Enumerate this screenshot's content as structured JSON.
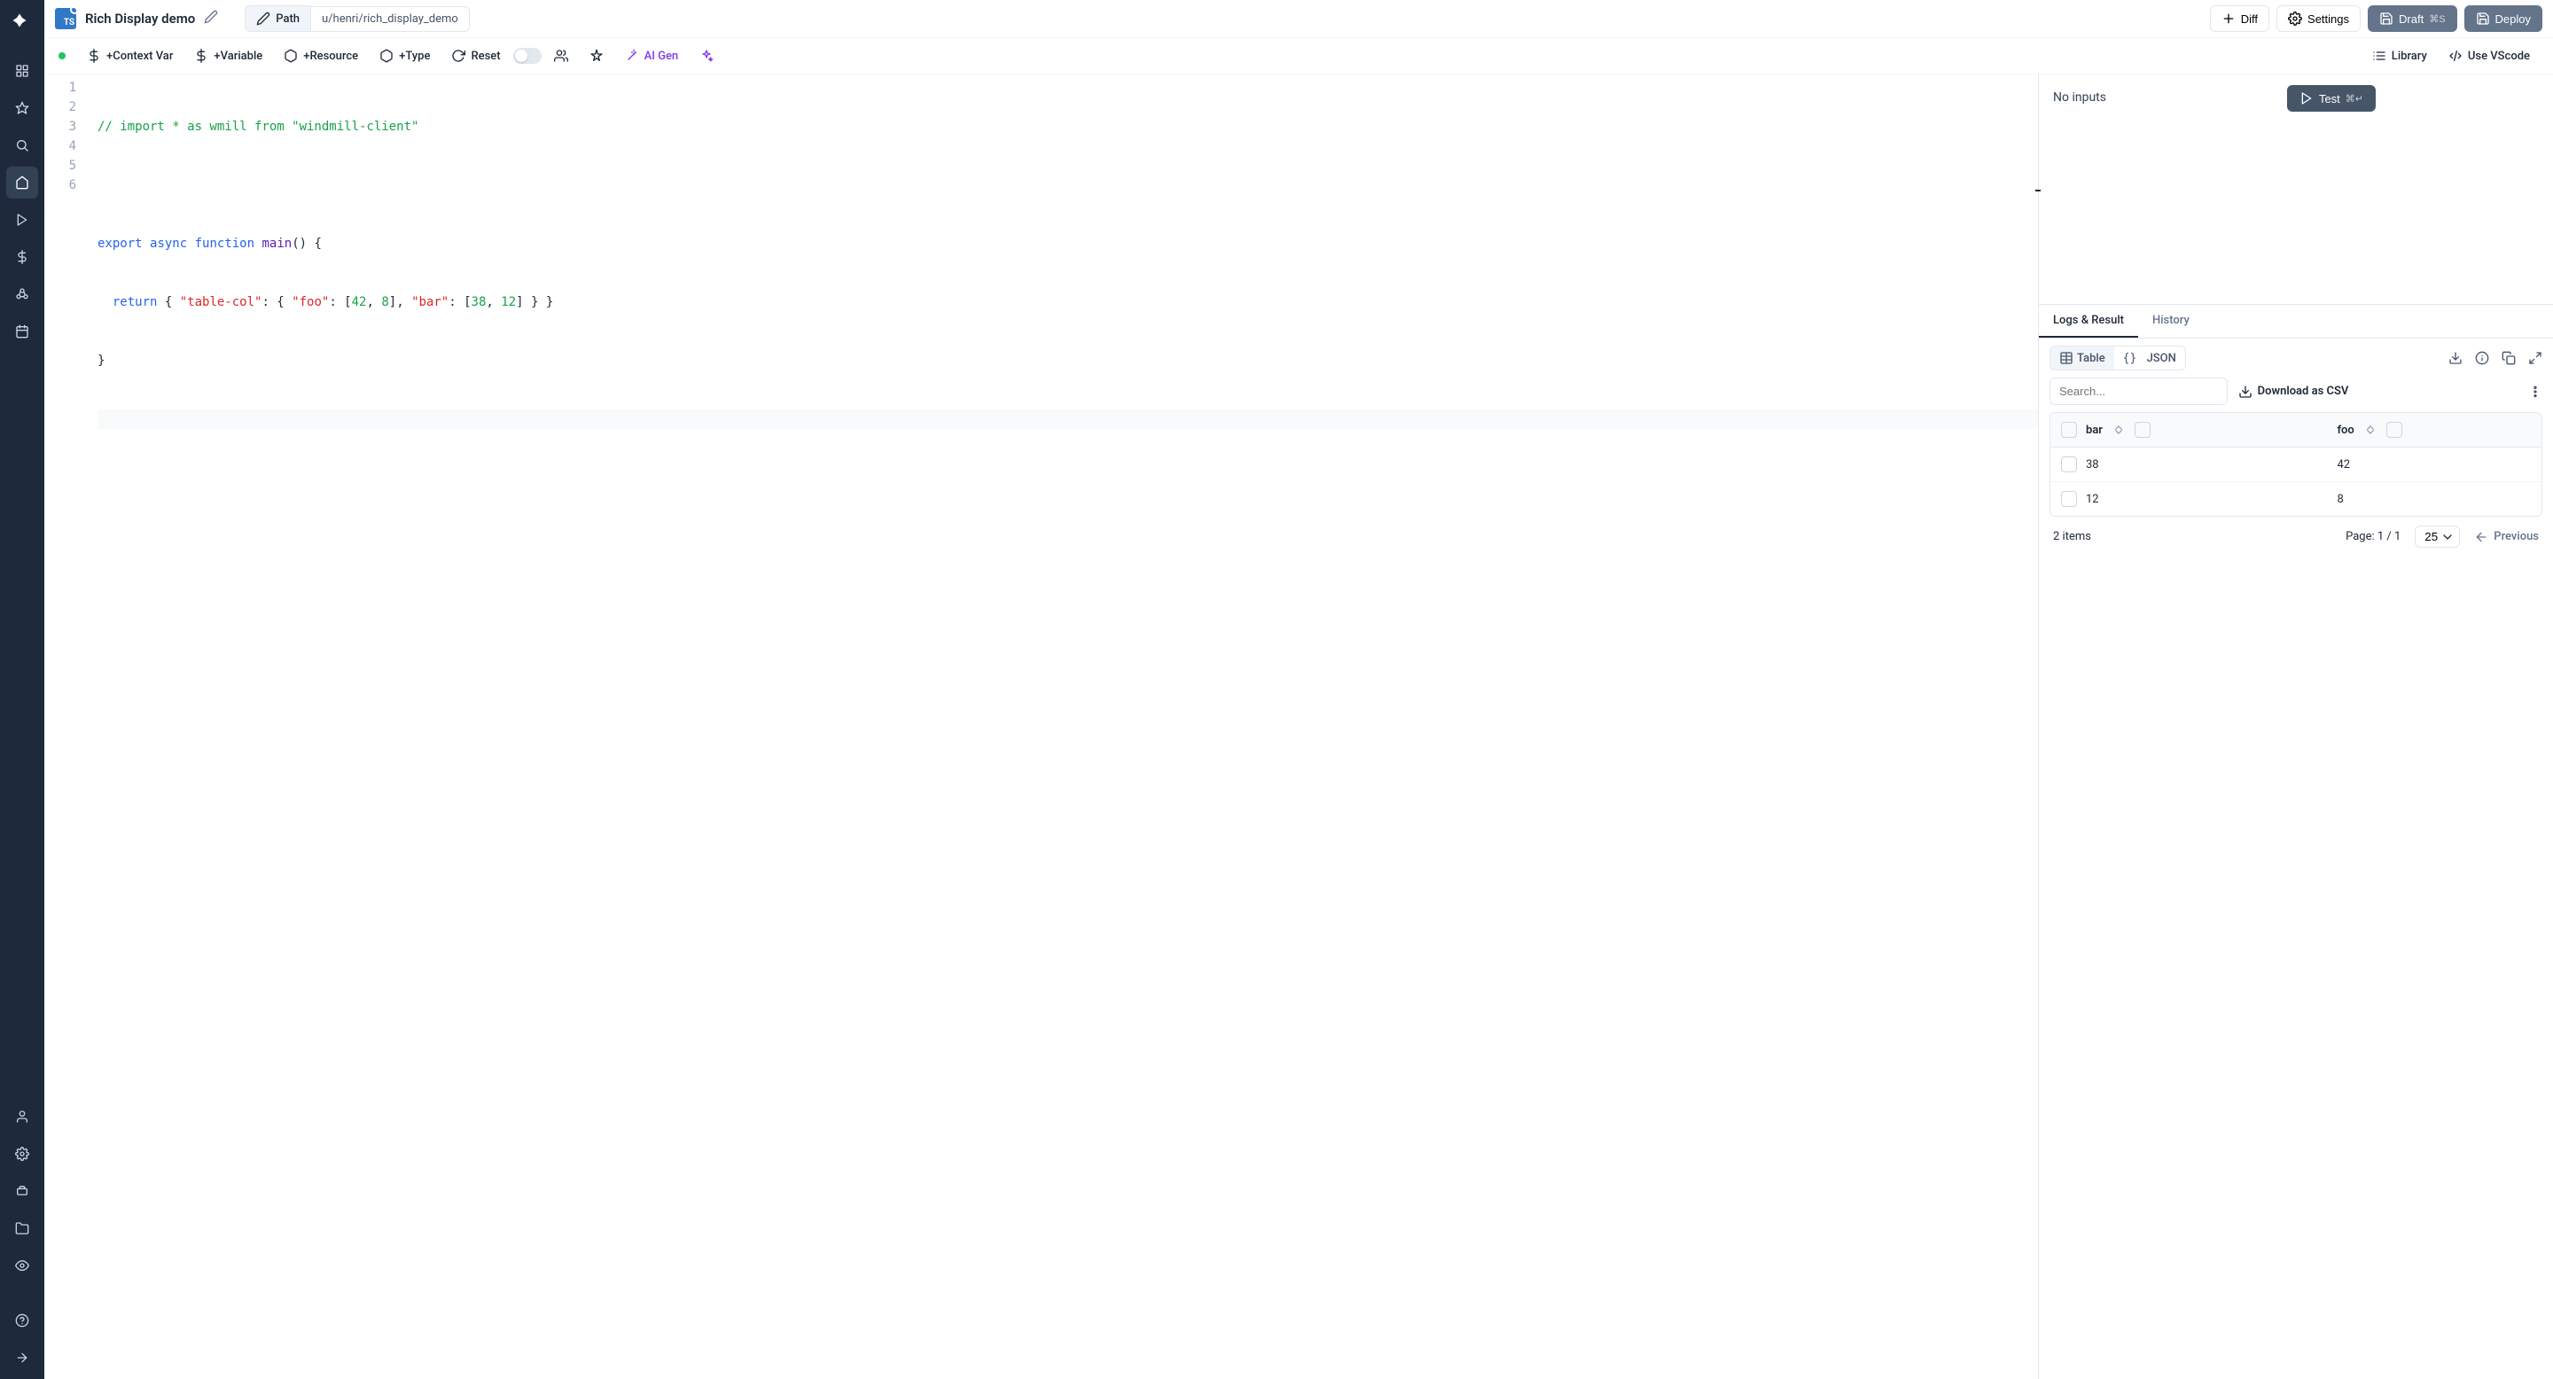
{
  "header": {
    "file_badge": "TS",
    "title": "Rich Display demo",
    "path_label": "Path",
    "path_value": "u/henri/rich_display_demo",
    "diff": "Diff",
    "settings": "Settings",
    "draft": "Draft",
    "draft_kbd": "⌘S",
    "deploy": "Deploy"
  },
  "toolbar": {
    "context_var": "+Context Var",
    "variable": "+Variable",
    "resource": "+Resource",
    "type": "+Type",
    "reset": "Reset",
    "ai_gen": "AI Gen",
    "library": "Library",
    "use_vscode": "Use VScode"
  },
  "editor": {
    "lines": [
      "1",
      "2",
      "3",
      "4",
      "5",
      "6"
    ],
    "line1_comment": "// import * as wmill from \"windmill-client\"",
    "line3_export": "export",
    "line3_async": "async",
    "line3_function": "function",
    "line3_main": "main",
    "line3_paren": "()",
    "line3_brace": " {",
    "line4_return": "return",
    "line4_brace1": " { ",
    "line4_key1": "\"table-col\"",
    "line4_colon1": ": { ",
    "line4_key2": "\"foo\"",
    "line4_colon2": ": [",
    "line4_n1": "42",
    "line4_c1": ", ",
    "line4_n2": "8",
    "line4_b1": "], ",
    "line4_key3": "\"bar\"",
    "line4_colon3": ": [",
    "line4_n3": "38",
    "line4_c2": ", ",
    "line4_n4": "12",
    "line4_b2": "] } }",
    "line5": "}"
  },
  "right": {
    "test": "Test",
    "test_kbd": "⌘↵",
    "no_inputs": "No inputs",
    "tabs": {
      "logs": "Logs & Result",
      "history": "History"
    },
    "view": {
      "table": "Table",
      "json": "JSON"
    },
    "search_placeholder": "Search...",
    "download_csv": "Download as CSV",
    "table": {
      "columns": [
        "bar",
        "foo"
      ],
      "rows": [
        {
          "bar": "38",
          "foo": "42"
        },
        {
          "bar": "12",
          "foo": "8"
        }
      ]
    },
    "items_count": "2 items",
    "page_label": "Page: 1 / 1",
    "page_size": "25",
    "previous": "Previous"
  }
}
